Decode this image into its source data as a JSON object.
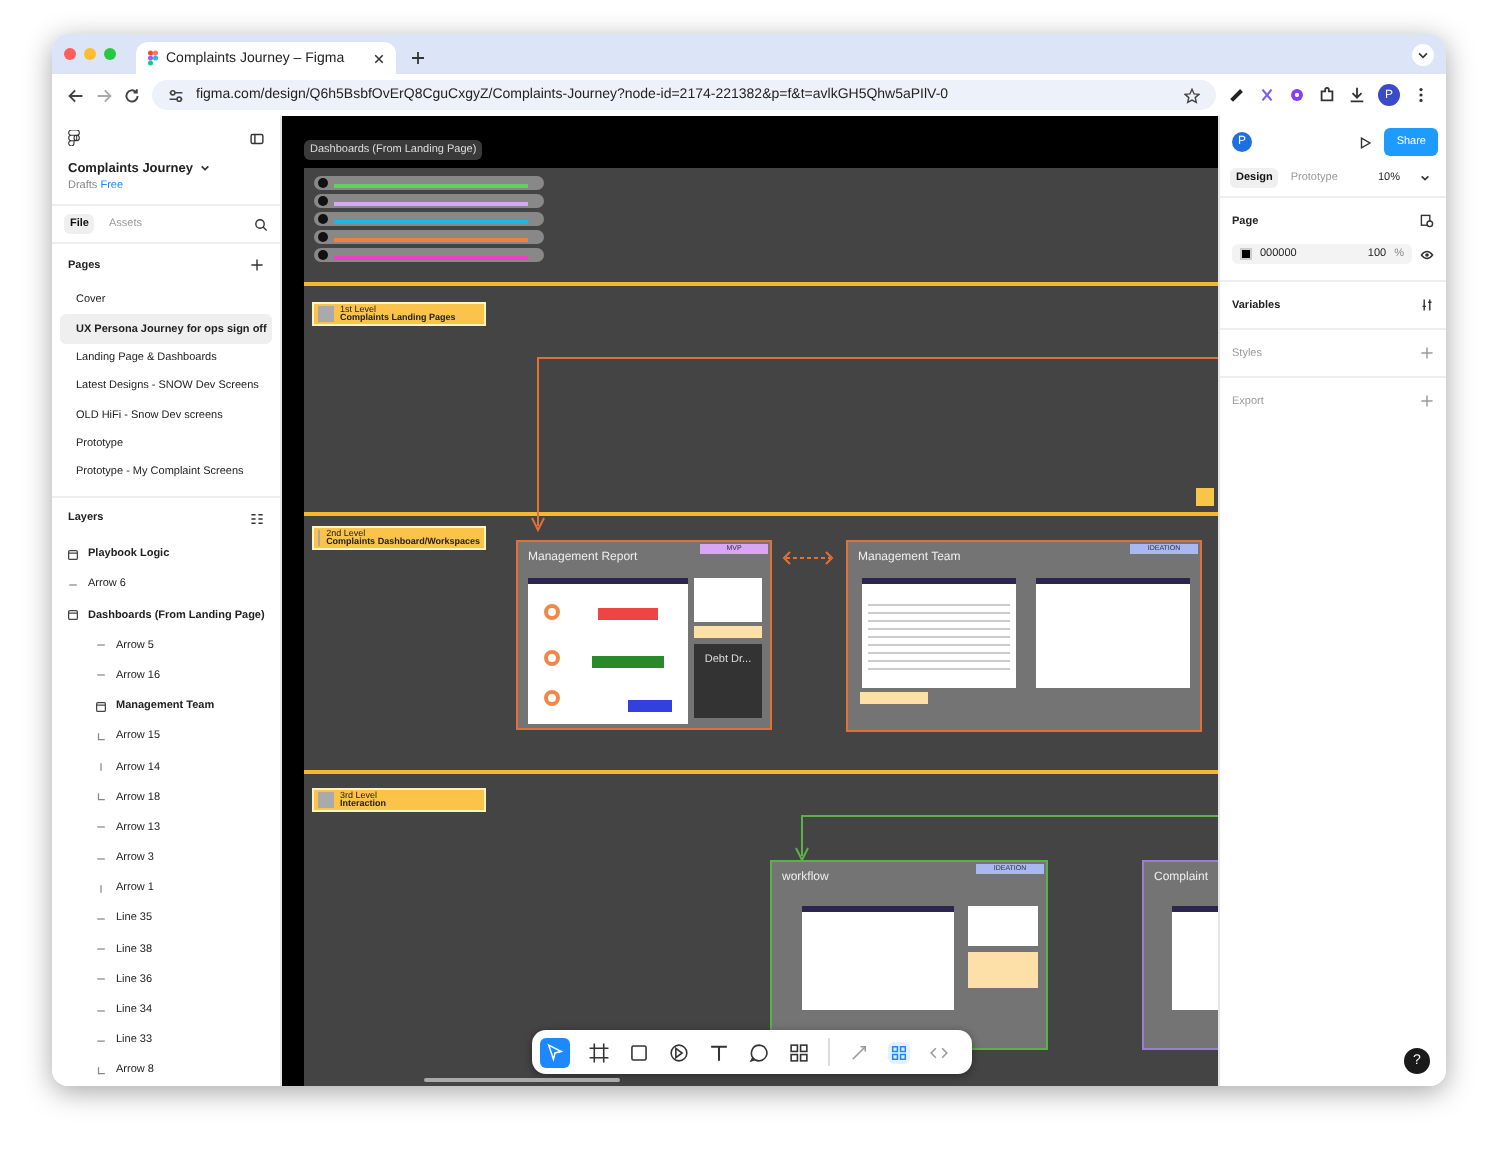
{
  "browser": {
    "tab_title": "Complaints Journey – Figma",
    "url": "figma.com/design/Q6h5BsbfOvErQ8CguCxgyZ/Complaints-Journey?node-id=2174-221382&p=f&t=avlkGH5Qhw5aPIlV-0",
    "profile_initial": "P"
  },
  "sidebar": {
    "file_name": "Complaints Journey",
    "location": "Drafts",
    "plan": "Free",
    "tabs": [
      {
        "label": "File",
        "selected": true
      },
      {
        "label": "Assets",
        "selected": false
      }
    ],
    "pages_heading": "Pages",
    "pages": [
      {
        "label": "Cover",
        "selected": false
      },
      {
        "label": "UX Persona Journey for ops sign off",
        "selected": true
      },
      {
        "label": "Landing Page & Dashboards",
        "selected": false
      },
      {
        "label": "Latest Designs - SNOW Dev Screens",
        "selected": false
      },
      {
        "label": "OLD HiFi - Snow Dev screens",
        "selected": false
      },
      {
        "label": "Prototype",
        "selected": false
      },
      {
        "label": "Prototype - My Complaint Screens",
        "selected": false
      }
    ],
    "layers_heading": "Layers",
    "layers": [
      {
        "label": "Playbook Logic",
        "kind": "frame"
      },
      {
        "label": "Arrow 6",
        "kind": "line"
      },
      {
        "label": "Dashboards (From Landing Page)",
        "kind": "frame",
        "children": [
          {
            "label": "Arrow 5",
            "kind": "line"
          },
          {
            "label": "Arrow 16",
            "kind": "line"
          },
          {
            "label": "Management Team",
            "kind": "frame"
          },
          {
            "label": "Arrow 15",
            "kind": "elbow"
          },
          {
            "label": "Arrow 14",
            "kind": "vline"
          },
          {
            "label": "Arrow 18",
            "kind": "elbow"
          },
          {
            "label": "Arrow 13",
            "kind": "line"
          },
          {
            "label": "Arrow 3",
            "kind": "line"
          },
          {
            "label": "Arrow 1",
            "kind": "vline"
          },
          {
            "label": "Line 35",
            "kind": "line"
          },
          {
            "label": "Line 38",
            "kind": "line"
          },
          {
            "label": "Line 36",
            "kind": "line"
          },
          {
            "label": "Line 34",
            "kind": "line"
          },
          {
            "label": "Line 33",
            "kind": "line"
          },
          {
            "label": "Arrow 8",
            "kind": "elbow"
          }
        ]
      }
    ]
  },
  "canvas": {
    "frame_label": "Dashboards (From Landing Page)",
    "legend": [
      {
        "color": "#5fd35a"
      },
      {
        "color": "#d6a8f7"
      },
      {
        "color": "#1fb6e0"
      },
      {
        "color": "#f08040"
      },
      {
        "color": "#f03cc8"
      }
    ],
    "levels": [
      {
        "tier": "1st Level",
        "title": "Complaints Landing Pages"
      },
      {
        "tier": "2nd Level",
        "title": "Complaints Dashboard/Workspaces"
      },
      {
        "tier": "3rd Level",
        "title": "Interaction"
      }
    ],
    "cards": [
      {
        "title": "Management Report",
        "badge": {
          "label": "MVP",
          "kind": "mvp"
        },
        "color": "#e0703a",
        "note": "Debt Dr..."
      },
      {
        "title": "Management Team",
        "badge": {
          "label": "IDEATION",
          "kind": "ideation"
        },
        "color": "#e0703a"
      },
      {
        "title": "workflow",
        "badge": {
          "label": "IDEATION",
          "kind": "ideation"
        },
        "color": "#5cb04a"
      },
      {
        "title": "Complaint",
        "color": "#9a7fd0"
      }
    ]
  },
  "right_panel": {
    "avatar": "P",
    "share": "Share",
    "tabs": [
      {
        "label": "Design",
        "selected": true
      },
      {
        "label": "Prototype",
        "selected": false
      }
    ],
    "zoom": "10%",
    "page_heading": "Page",
    "page_color": "000000",
    "opacity": "100",
    "opacity_unit": "%",
    "sections": [
      "Variables",
      "Styles",
      "Export"
    ]
  },
  "help": "?"
}
